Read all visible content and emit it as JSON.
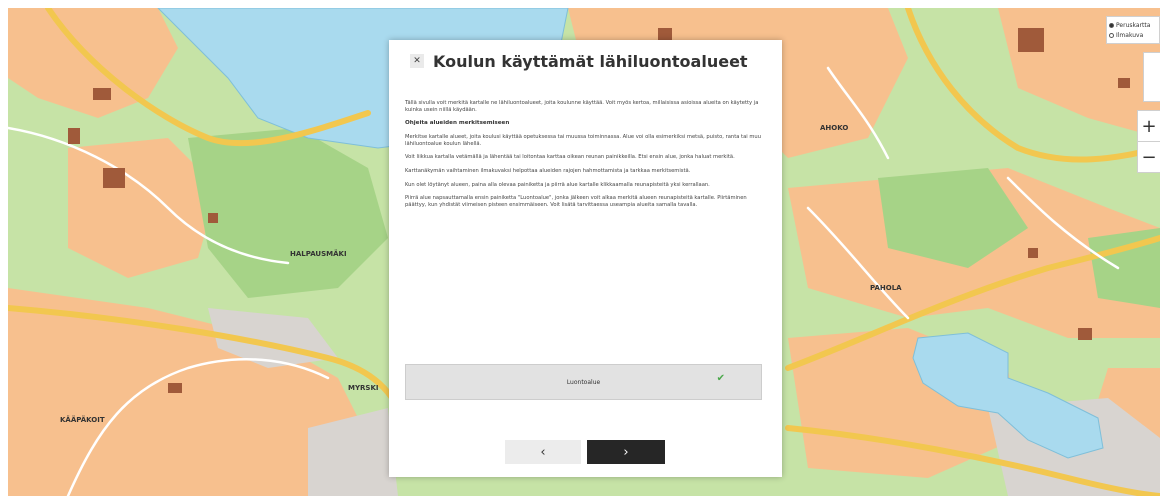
{
  "colors": {
    "land": "#c6e3a6",
    "forest": "#a6d387",
    "urban": "#f7c08e",
    "water": "#a9daee",
    "road_major": "#f2c74f",
    "road_minor": "#ffffff",
    "building": "#a05a3a",
    "gray_area": "#d8d4d0",
    "accent_check": "#4ba84b",
    "next_button": "#262626"
  },
  "map": {
    "labels": [
      {
        "text": "HALPAUSMÄKI"
      },
      {
        "text": "AHOKO"
      },
      {
        "text": "PAHOLA"
      },
      {
        "text": "KÄÄPÄKOIT"
      },
      {
        "text": "MYRSKI"
      }
    ],
    "layer_switcher": {
      "options": [
        {
          "label": "Peruskartta",
          "selected": true
        },
        {
          "label": "Ilmakuva",
          "selected": false
        }
      ]
    },
    "zoom": {
      "in_label": "+",
      "out_label": "−"
    }
  },
  "dialog": {
    "close_label": "✕",
    "title": "Koulun käyttämät lähiluontoalueet",
    "intro": "Tällä sivulla voit merkitä kartalle ne lähiluontoalueet, joita koulunne käyttää. Voit myös kertoa, millaisissa asioissa alueita on käytetty ja kuinka usein niillä käydään.",
    "instructions_heading": "Ohjeita alueiden merkitsemiseen",
    "paragraphs": [
      "Merkitse kartalle alueet, joita koulusi käyttää opetuksessa tai muussa toiminnassa. Alue voi olla esimerkiksi metsä, puisto, ranta tai muu lähiluontoalue koulun lähellä.",
      "Voit liikkua kartalla vetämällä ja lähentää tai loitontaa karttaa oikean reunan painikkeilla. Etsi ensin alue, jonka haluat merkitä.",
      "Karttanäkymän vaihtaminen ilmakuvaksi helpottaa alueiden rajojen hahmottamista ja tarkkaa merkitsemistä.",
      "Kun olet löytänyt alueen, paina alla olevaa painiketta ja piirrä alue kartalle klikkaamalla reunapisteitä yksi kerrallaan.",
      "Piirrä alue napsauttamalla ensin painiketta \"Luontoalue\", jonka jälkeen voit alkaa merkitä alueen reunapisteitä kartalle. Piirtäminen päättyy, kun yhdistät viimeisen pisteen ensimmäiseen. Voit lisätä tarvittaessa useampia alueita samalla tavalla."
    ],
    "area_button_label": "Luontoalue",
    "area_button_check": "✔",
    "prev_label": "‹",
    "next_label": "›"
  }
}
